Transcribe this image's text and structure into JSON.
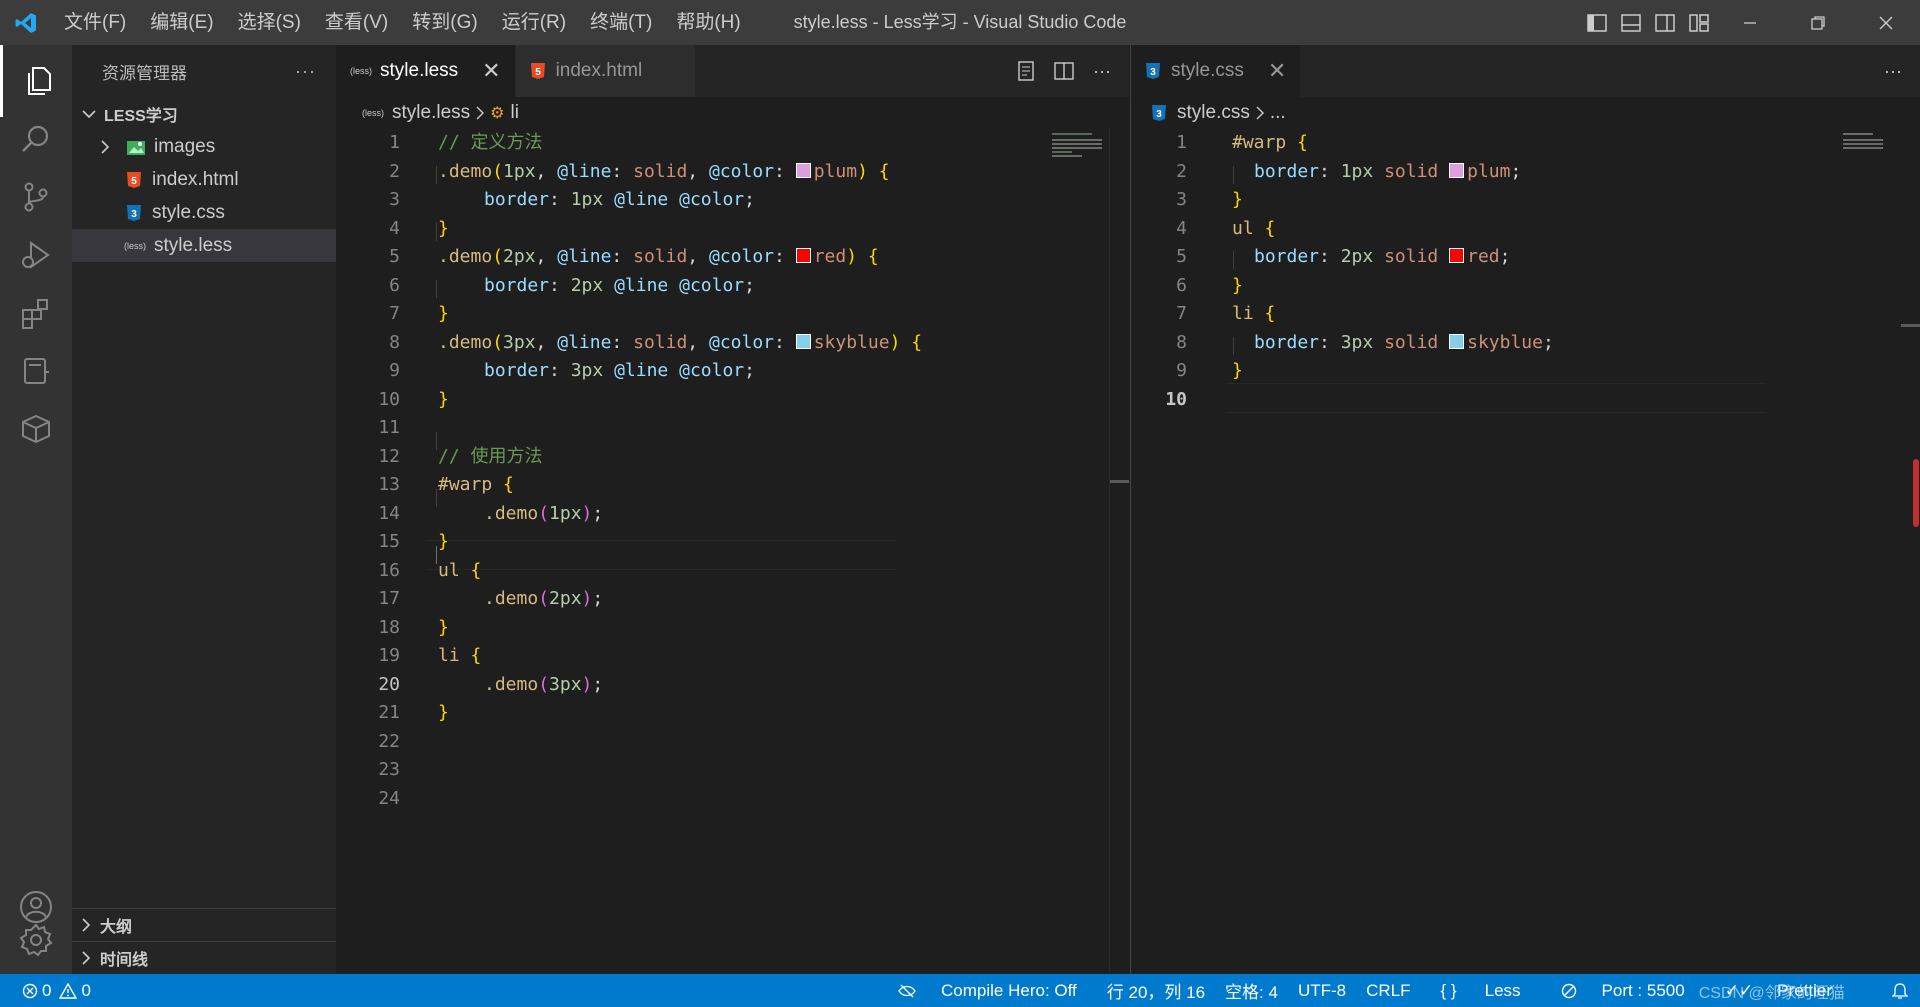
{
  "titlebar": {
    "menu": [
      "文件(F)",
      "编辑(E)",
      "选择(S)",
      "查看(V)",
      "转到(G)",
      "运行(R)",
      "终端(T)",
      "帮助(H)"
    ],
    "title": "style.less - Less学习 - Visual Studio Code"
  },
  "sidebar": {
    "header": "资源管理器",
    "more": "···",
    "folder": "LESS学习",
    "files": [
      {
        "name": "images",
        "icon": "folder-image-icon"
      },
      {
        "name": "index.html",
        "icon": "html-icon"
      },
      {
        "name": "style.css",
        "icon": "css-icon"
      },
      {
        "name": "style.less",
        "icon": "less-icon"
      }
    ],
    "outline": "大纲",
    "timeline": "时间线"
  },
  "editor_left": {
    "tabs": [
      {
        "label": "style.less",
        "badge": "(less)",
        "close": "✕"
      },
      {
        "label": "index.html"
      }
    ],
    "breadcrumb": {
      "file": "style.less",
      "symbol": "li"
    },
    "current_line": "20"
  },
  "editor_right": {
    "tabs": [
      {
        "label": "style.css",
        "close": "✕"
      }
    ],
    "breadcrumb": {
      "file": "style.css",
      "rest": "..."
    },
    "current_line": "10"
  },
  "colors": {
    "plum": "#dda0dd",
    "red": "#ff0000",
    "skyblue": "#87ceeb",
    "accent": "#007acc"
  },
  "less_lines": [
    "1",
    "2",
    "3",
    "4",
    "5",
    "6",
    "7",
    "8",
    "9",
    "10",
    "11",
    "12",
    "13",
    "14",
    "15",
    "16",
    "17",
    "18",
    "19",
    "20",
    "21",
    "22",
    "23",
    "24"
  ],
  "css_lines": [
    "1",
    "2",
    "3",
    "4",
    "5",
    "6",
    "7",
    "8",
    "9",
    "10"
  ],
  "less_code": {
    "c1": "// 定义方法",
    "c12": "// 使用方法",
    "demo": ".demo",
    "p1": "1px",
    "p2": "2px",
    "p3": "3px",
    "line_var": "@line",
    "color_var": "@color",
    "solid": "solid",
    "plum": "plum",
    "red": "red",
    "skyblue": "skyblue",
    "border": "border",
    "warp": "#warp",
    "ul": "ul",
    "li": "li"
  },
  "statusbar": {
    "errors": "0",
    "warnings": "0",
    "compile": "Compile Hero: Off",
    "position": "行 20，列 16",
    "spaces": "空格: 4",
    "encoding": "UTF-8",
    "eol": "CRLF",
    "language": "Less",
    "port": "Port : 5500",
    "prettier": "Prettier",
    "watermark": "CSDN @邻家的旺猫"
  }
}
